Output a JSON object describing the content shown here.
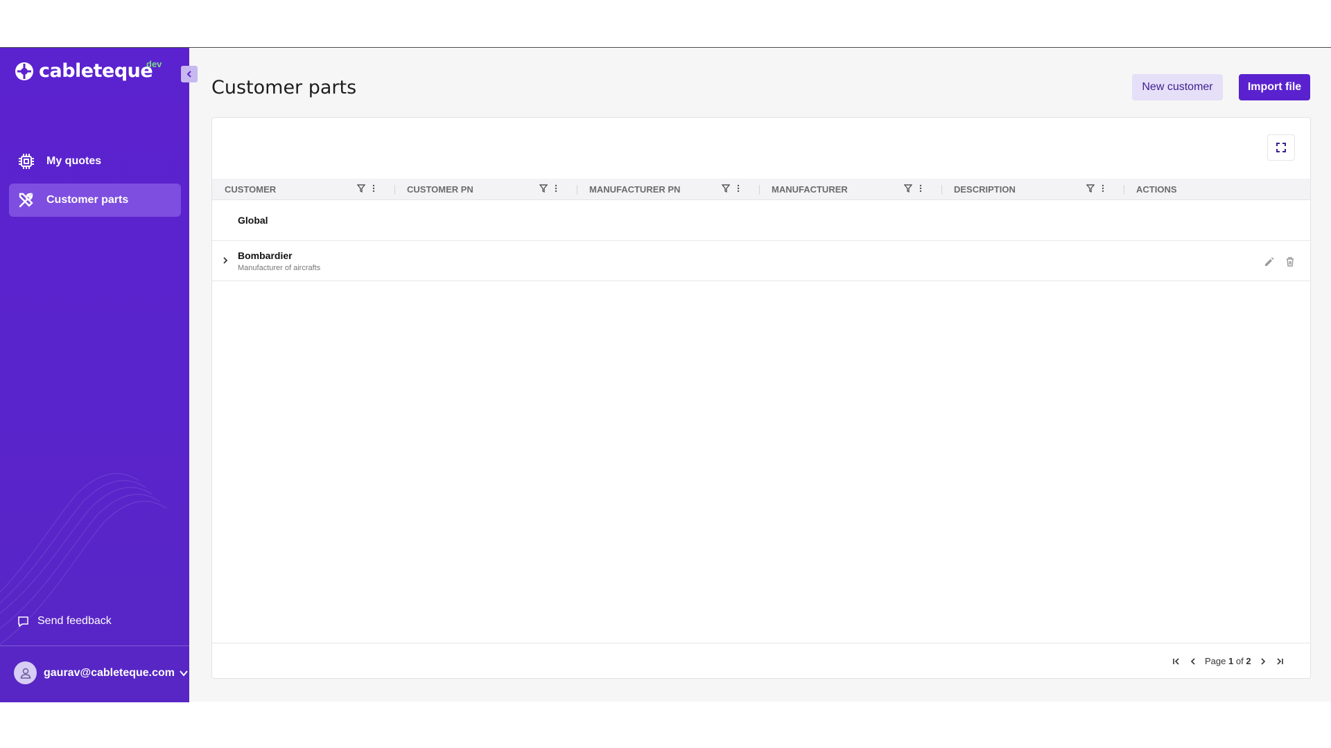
{
  "brand": {
    "name": "cableteque",
    "env": "dev"
  },
  "sidebar": {
    "items": [
      {
        "label": "My quotes",
        "icon": "chip-icon",
        "active": false
      },
      {
        "label": "Customer parts",
        "icon": "tools-icon",
        "active": true
      }
    ],
    "feedback_label": "Send feedback",
    "user_email": "gaurav@cableteque.com"
  },
  "page": {
    "title": "Customer parts",
    "new_customer_label": "New customer",
    "import_label": "Import file"
  },
  "table": {
    "columns": [
      "CUSTOMER",
      "CUSTOMER PN",
      "MANUFACTURER PN",
      "MANUFACTURER",
      "DESCRIPTION",
      "ACTIONS"
    ],
    "rows": [
      {
        "title": "Global",
        "subtitle": ""
      },
      {
        "title": "Bombardier",
        "subtitle": "Manufacturer of aircrafts"
      }
    ]
  },
  "pagination": {
    "page_label": "Page",
    "current": "1",
    "of_label": "of",
    "total": "2"
  },
  "colors": {
    "sidebar": "#5b22cf",
    "primary": "#5a22cf",
    "secondary_bg": "#e6dff8"
  }
}
